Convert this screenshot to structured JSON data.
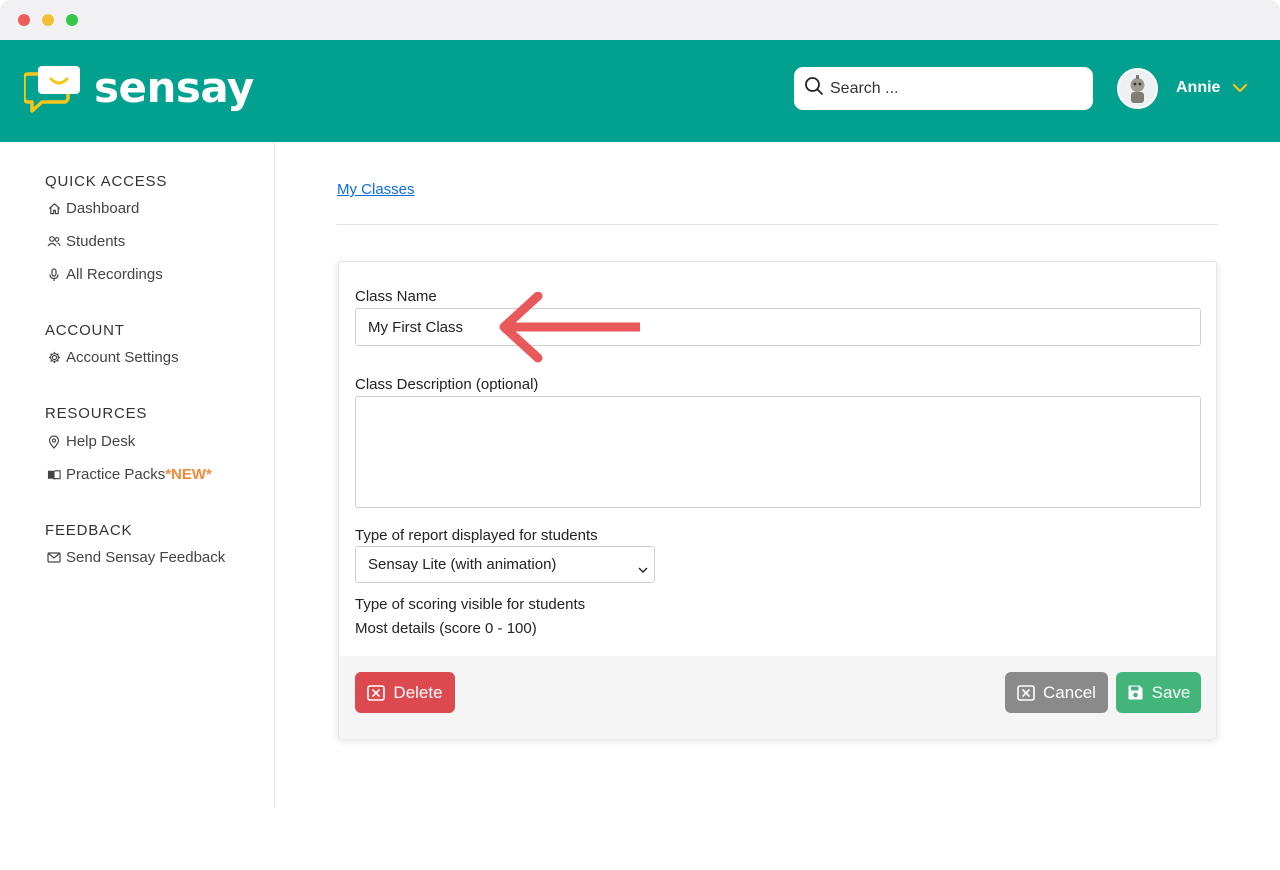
{
  "window": {
    "controls": [
      "close",
      "minimize",
      "maximize"
    ]
  },
  "header": {
    "brand": "sensay",
    "logo_icon": "chat-bubble-smile-icon",
    "search": {
      "placeholder": "Search ...",
      "value": ""
    },
    "user": {
      "name": "Annie"
    },
    "colors": {
      "header_bg": "#02a08f",
      "logo_yellow": "#f5c518"
    }
  },
  "sidebar": {
    "sections": [
      {
        "title": "QUICK ACCESS",
        "items": [
          {
            "label": "Dashboard",
            "icon": "home-icon"
          },
          {
            "label": "Students",
            "icon": "users-icon"
          },
          {
            "label": "All Recordings",
            "icon": "mic-icon"
          }
        ]
      },
      {
        "title": "ACCOUNT",
        "items": [
          {
            "label": "Account Settings",
            "icon": "gear-icon"
          }
        ]
      },
      {
        "title": "RESOURCES",
        "items": [
          {
            "label": "Help Desk",
            "icon": "pin-icon"
          },
          {
            "label": "Practice Packs",
            "badge": "*NEW*",
            "icon": "book-icon"
          }
        ]
      },
      {
        "title": "FEEDBACK",
        "items": [
          {
            "label": "Send Sensay Feedback",
            "icon": "mail-icon"
          }
        ]
      }
    ]
  },
  "main": {
    "breadcrumb": "My Classes",
    "form": {
      "class_name_label": "Class Name",
      "class_name_value": "My First Class",
      "description_label": "Class Description (optional)",
      "description_value": "",
      "report_type_label": "Type of report displayed for students",
      "report_type_value": "Sensay Lite (with animation)",
      "scoring_label": "Type of scoring visible for students",
      "scoring_value": "Most details (score 0 - 100)"
    },
    "buttons": {
      "delete": "Delete",
      "cancel": "Cancel",
      "save": "Save"
    },
    "colors": {
      "delete": "#dc4a4f",
      "cancel": "#8a8a8a",
      "save": "#43b57b",
      "annotation_arrow": "#e85a5a"
    }
  }
}
